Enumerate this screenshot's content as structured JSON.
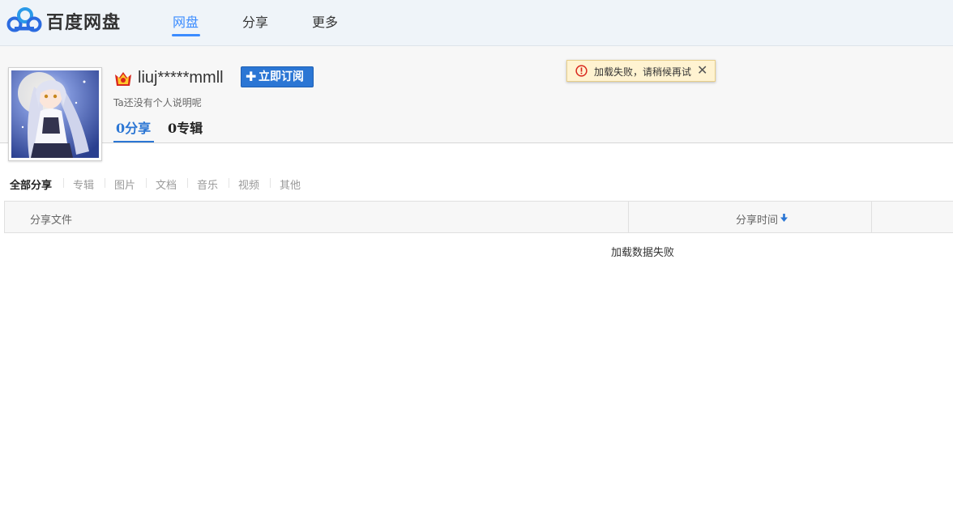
{
  "brand": {
    "name": "百度网盘"
  },
  "nav": {
    "items": [
      "网盘",
      "分享",
      "更多"
    ],
    "active": "网盘"
  },
  "profile": {
    "username": "liuj*****mmll",
    "subscribe_label": "立即订阅",
    "bio": "Ta还没有个人说明呢",
    "tabs": [
      "0分享",
      "0专辑"
    ]
  },
  "toast": {
    "message": "加载失败，请稍候再试"
  },
  "filters": [
    "全部分享",
    "专辑",
    "图片",
    "文档",
    "音乐",
    "视频",
    "其他"
  ],
  "table": {
    "col_file": "分享文件",
    "col_time": "分享时间",
    "empty_message": "加载数据失败"
  },
  "colors": {
    "accent": "#2b76d4",
    "nav_active": "#3b8cff",
    "toast_bg": "#fff3d1",
    "error_red": "#d9261c"
  },
  "icons": [
    "baidu-cloud-logo-icon",
    "vip-crown-icon",
    "plus-icon",
    "warning-icon",
    "close-icon",
    "sort-down-icon"
  ]
}
